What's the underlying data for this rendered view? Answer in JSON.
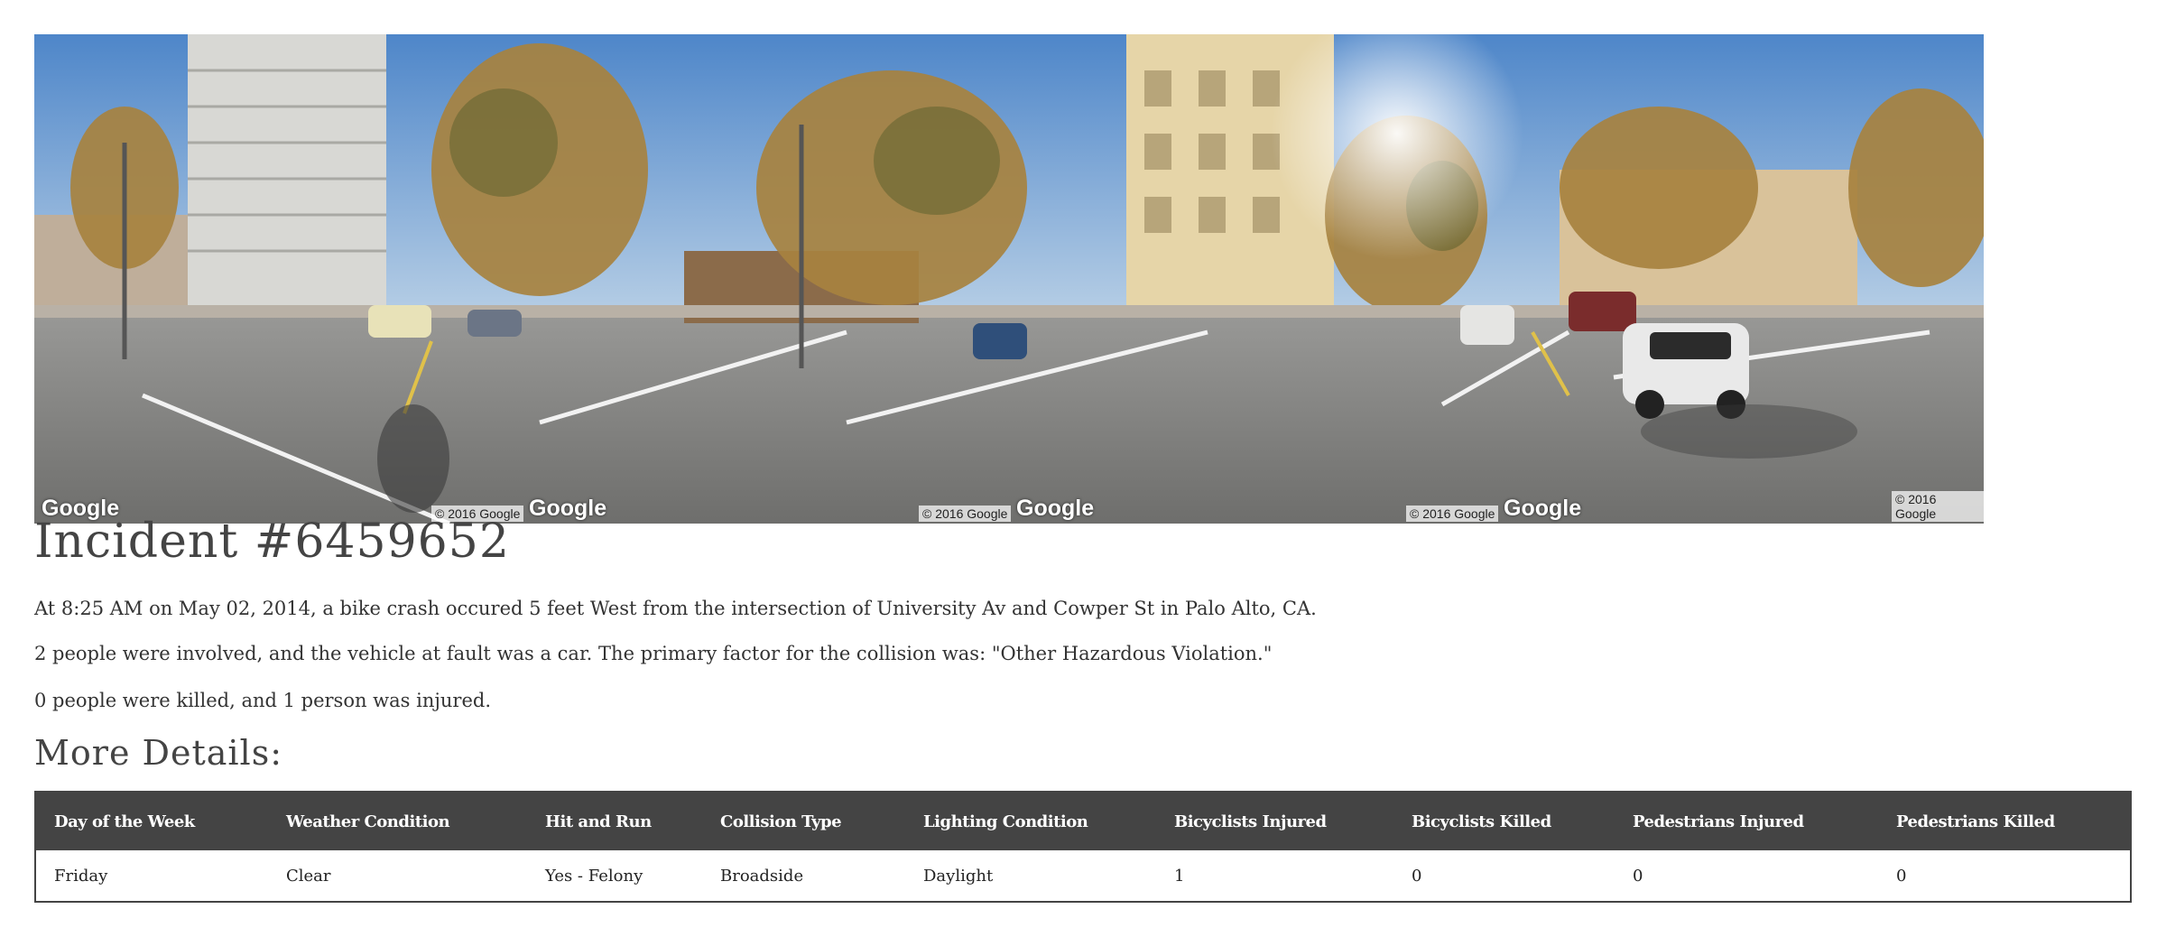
{
  "panorama": {
    "alt": "Street view panorama",
    "watermarks": [
      "Google",
      "Google",
      "Google",
      "Google"
    ],
    "copyrights": [
      "© 2016 Google",
      "© 2016 Google",
      "© 2016 Google",
      "© 2016 Google"
    ]
  },
  "incident": {
    "title": "Incident #6459652",
    "line1": "At 8:25 AM on May 02, 2014, a bike crash occured 5 feet West from the intersection of University Av and Cowper St in Palo Alto, CA.",
    "line2": "2 people were involved, and the vehicle at fault was a car. The primary factor for the collision was: \"Other Hazardous Violation.\"",
    "line3": "0 people were killed, and 1 person was injured."
  },
  "details": {
    "heading": "More Details:",
    "headers": [
      "Day of the Week",
      "Weather Condition",
      "Hit and Run",
      "Collision Type",
      "Lighting Condition",
      "Bicyclists Injured",
      "Bicyclists Killed",
      "Pedestrians Injured",
      "Pedestrians Killed"
    ],
    "row": [
      "Friday",
      "Clear",
      "Yes - Felony",
      "Broadside",
      "Daylight",
      "1",
      "0",
      "0",
      "0"
    ]
  },
  "colors": {
    "table_header_bg": "#444444",
    "heading_text": "#444444"
  }
}
